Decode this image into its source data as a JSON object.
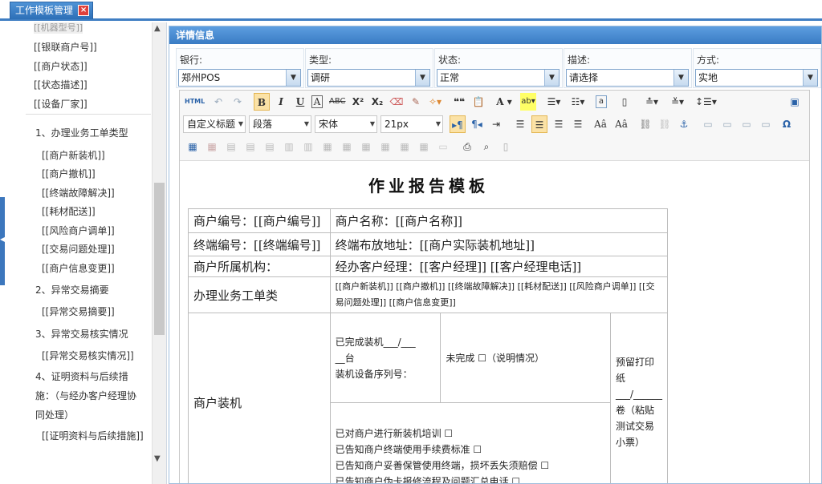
{
  "tab": {
    "label": "工作模板管理"
  },
  "sidebar": {
    "top_cut": "[[机器型号]]",
    "fields": [
      "[[银联商户号]]",
      "[[商户状态]]",
      "[[状态描述]]",
      "[[设备厂家]]"
    ],
    "sections": [
      {
        "title": "1、办理业务工单类型",
        "items": [
          "[[商户新装机]]",
          "[[商户撤机]]",
          "[[终端故障解决]]",
          "[[耗材配送]]",
          "[[风险商户调单]]",
          "[[交易问题处理]]",
          "[[商户信息变更]]"
        ]
      },
      {
        "title": "2、异常交易摘要",
        "items": [
          "[[异常交易摘要]]"
        ]
      },
      {
        "title": "3、异常交易核实情况",
        "items": [
          "[[异常交易核实情况]]"
        ]
      },
      {
        "title": "4、证明资料与后续措施：（与经办客户经理协同处理）",
        "items": [
          "[[证明资料与后续措施]]"
        ]
      }
    ]
  },
  "panel": {
    "title": "详情信息"
  },
  "filters": [
    {
      "label": "银行:",
      "value": "郑州POS"
    },
    {
      "label": "类型:",
      "value": "调研"
    },
    {
      "label": "状态:",
      "value": "正常"
    },
    {
      "label": "描述:",
      "value": "请选择"
    },
    {
      "label": "方式:",
      "value": "实地"
    }
  ],
  "toolbar": {
    "style": "自定义标题",
    "paragraph": "段落",
    "font": "宋体",
    "size": "21px"
  },
  "doc": {
    "title": "作业报告模板",
    "row1": {
      "a": "商户编号：[[商户编号]]",
      "b": "商户名称：[[商户名称]]"
    },
    "row2": {
      "a": "终端编号：[[终端编号]]",
      "b": "终端布放地址：[[商户实际装机地址]]"
    },
    "row3": {
      "a": "商户所属机构：",
      "b": "经办客户经理：[[客户经理]] [[客户经理电话]]"
    },
    "row4": {
      "a": "办理业务工单类",
      "b": "[[商户新装机]] [[商户撤机]] [[终端故障解决]] [[耗材配送]] [[风险商户调单]] [[交易问题处理]] [[商户信息变更]]"
    },
    "install": {
      "label": "商户装机",
      "done1": "已完成装机___/___",
      "done2": "__台",
      "done3": "装机设备序列号：",
      "undone": "未完成 ☐（说明情况）",
      "paper": "预留打印纸___/______卷（粘贴测试交易小票）",
      "check1": "已对商户进行新装机培训 ☐",
      "check2": "已告知商户终端使用手续费标准 ☐",
      "check3": "已告知商户妥善保管使用终端，损坏丢失须赔偿 ☐",
      "check4": "已告知商户伪卡报修流程及问题汇总电话 ☐"
    }
  }
}
